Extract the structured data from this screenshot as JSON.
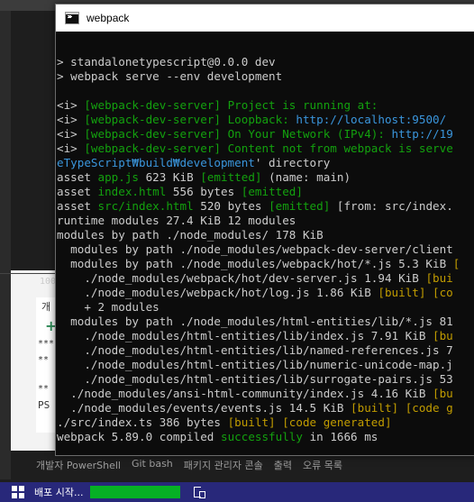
{
  "window": {
    "title": "webpack"
  },
  "console_lines": [
    [],
    [
      {
        "t": "> standalonetypescript@0.0.0 dev",
        "c": "w"
      }
    ],
    [
      {
        "t": "> webpack serve --env development",
        "c": "w"
      }
    ],
    [],
    [
      {
        "t": "<i> ",
        "c": "w"
      },
      {
        "t": "[webpack-dev-server] Project is running at:",
        "c": "g"
      }
    ],
    [
      {
        "t": "<i> ",
        "c": "w"
      },
      {
        "t": "[webpack-dev-server] Loopback: ",
        "c": "g"
      },
      {
        "t": "http://localhost:9500/",
        "c": "c"
      }
    ],
    [
      {
        "t": "<i> ",
        "c": "w"
      },
      {
        "t": "[webpack-dev-server] On Your Network (IPv4): ",
        "c": "g"
      },
      {
        "t": "http://19",
        "c": "c"
      }
    ],
    [
      {
        "t": "<i> ",
        "c": "w"
      },
      {
        "t": "[webpack-dev-server] Content not from webpack is serve",
        "c": "g"
      }
    ],
    [
      {
        "t": "eTypeScript₩build₩development",
        "c": "c"
      },
      {
        "t": "' directory",
        "c": "w"
      }
    ],
    [
      {
        "t": "asset ",
        "c": "w"
      },
      {
        "t": "app.js",
        "c": "g"
      },
      {
        "t": " 623 KiB ",
        "c": "w"
      },
      {
        "t": "[emitted]",
        "c": "g"
      },
      {
        "t": " (name: main)",
        "c": "w"
      }
    ],
    [
      {
        "t": "asset ",
        "c": "w"
      },
      {
        "t": "index.html",
        "c": "g"
      },
      {
        "t": " 556 bytes ",
        "c": "w"
      },
      {
        "t": "[emitted]",
        "c": "g"
      }
    ],
    [
      {
        "t": "asset ",
        "c": "w"
      },
      {
        "t": "src/index.html",
        "c": "g"
      },
      {
        "t": " 520 bytes ",
        "c": "w"
      },
      {
        "t": "[emitted]",
        "c": "g"
      },
      {
        "t": " [from: src/index.",
        "c": "w"
      }
    ],
    [
      {
        "t": "runtime modules 27.4 KiB 12 modules",
        "c": "w"
      }
    ],
    [
      {
        "t": "modules by path ./node_modules/ 178 KiB",
        "c": "w"
      }
    ],
    [
      {
        "t": "  modules by path ./node_modules/webpack-dev-server/client",
        "c": "w"
      }
    ],
    [
      {
        "t": "  modules by path ./node_modules/webpack/hot/*.js 5.3 KiB ",
        "c": "w"
      },
      {
        "t": "[",
        "c": "y"
      }
    ],
    [
      {
        "t": "    ./node_modules/webpack/hot/dev-server.js 1.94 KiB ",
        "c": "w"
      },
      {
        "t": "[bui",
        "c": "y"
      }
    ],
    [
      {
        "t": "    ./node_modules/webpack/hot/log.js 1.86 KiB ",
        "c": "w"
      },
      {
        "t": "[built] [co",
        "c": "y"
      }
    ],
    [
      {
        "t": "    + 2 modules",
        "c": "w"
      }
    ],
    [
      {
        "t": "  modules by path ./node_modules/html-entities/lib/*.js 81",
        "c": "w"
      }
    ],
    [
      {
        "t": "    ./node_modules/html-entities/lib/index.js 7.91 KiB ",
        "c": "w"
      },
      {
        "t": "[bu",
        "c": "y"
      }
    ],
    [
      {
        "t": "    ./node_modules/html-entities/lib/named-references.js 7",
        "c": "w"
      }
    ],
    [
      {
        "t": "    ./node_modules/html-entities/lib/numeric-unicode-map.j",
        "c": "w"
      }
    ],
    [
      {
        "t": "    ./node_modules/html-entities/lib/surrogate-pairs.js 53",
        "c": "w"
      }
    ],
    [
      {
        "t": "  ./node_modules/ansi-html-community/index.js 4.16 KiB ",
        "c": "w"
      },
      {
        "t": "[bu",
        "c": "y"
      }
    ],
    [
      {
        "t": "  ./node_modules/events/events.js 14.5 KiB ",
        "c": "w"
      },
      {
        "t": "[built] [code g",
        "c": "y"
      }
    ],
    [
      {
        "t": "./src/index.ts 386 bytes ",
        "c": "w"
      },
      {
        "t": "[built] [code generated]",
        "c": "y"
      }
    ],
    [
      {
        "t": "webpack 5.89.0 compiled ",
        "c": "w"
      },
      {
        "t": "successfully",
        "c": "g"
      },
      {
        "t": " in 1666 ms",
        "c": "w"
      }
    ]
  ],
  "ide": {
    "side_labels": [
      "100",
      "개",
      "***",
      "**",
      "**",
      "PS"
    ],
    "bottom_tabs": [
      "개발자 PowerShell",
      "Git bash",
      "패키지 관리자 콘솔",
      "출력",
      "오류 목록"
    ]
  },
  "taskbar": {
    "label": "배포 시작...",
    "progress": 1.0
  },
  "colors": {
    "green": "#13a10e",
    "yellow": "#c19c00",
    "cyan": "#3a96dd",
    "text": "#cccccc",
    "taskbar": "#28287a",
    "progress": "#06b025"
  }
}
